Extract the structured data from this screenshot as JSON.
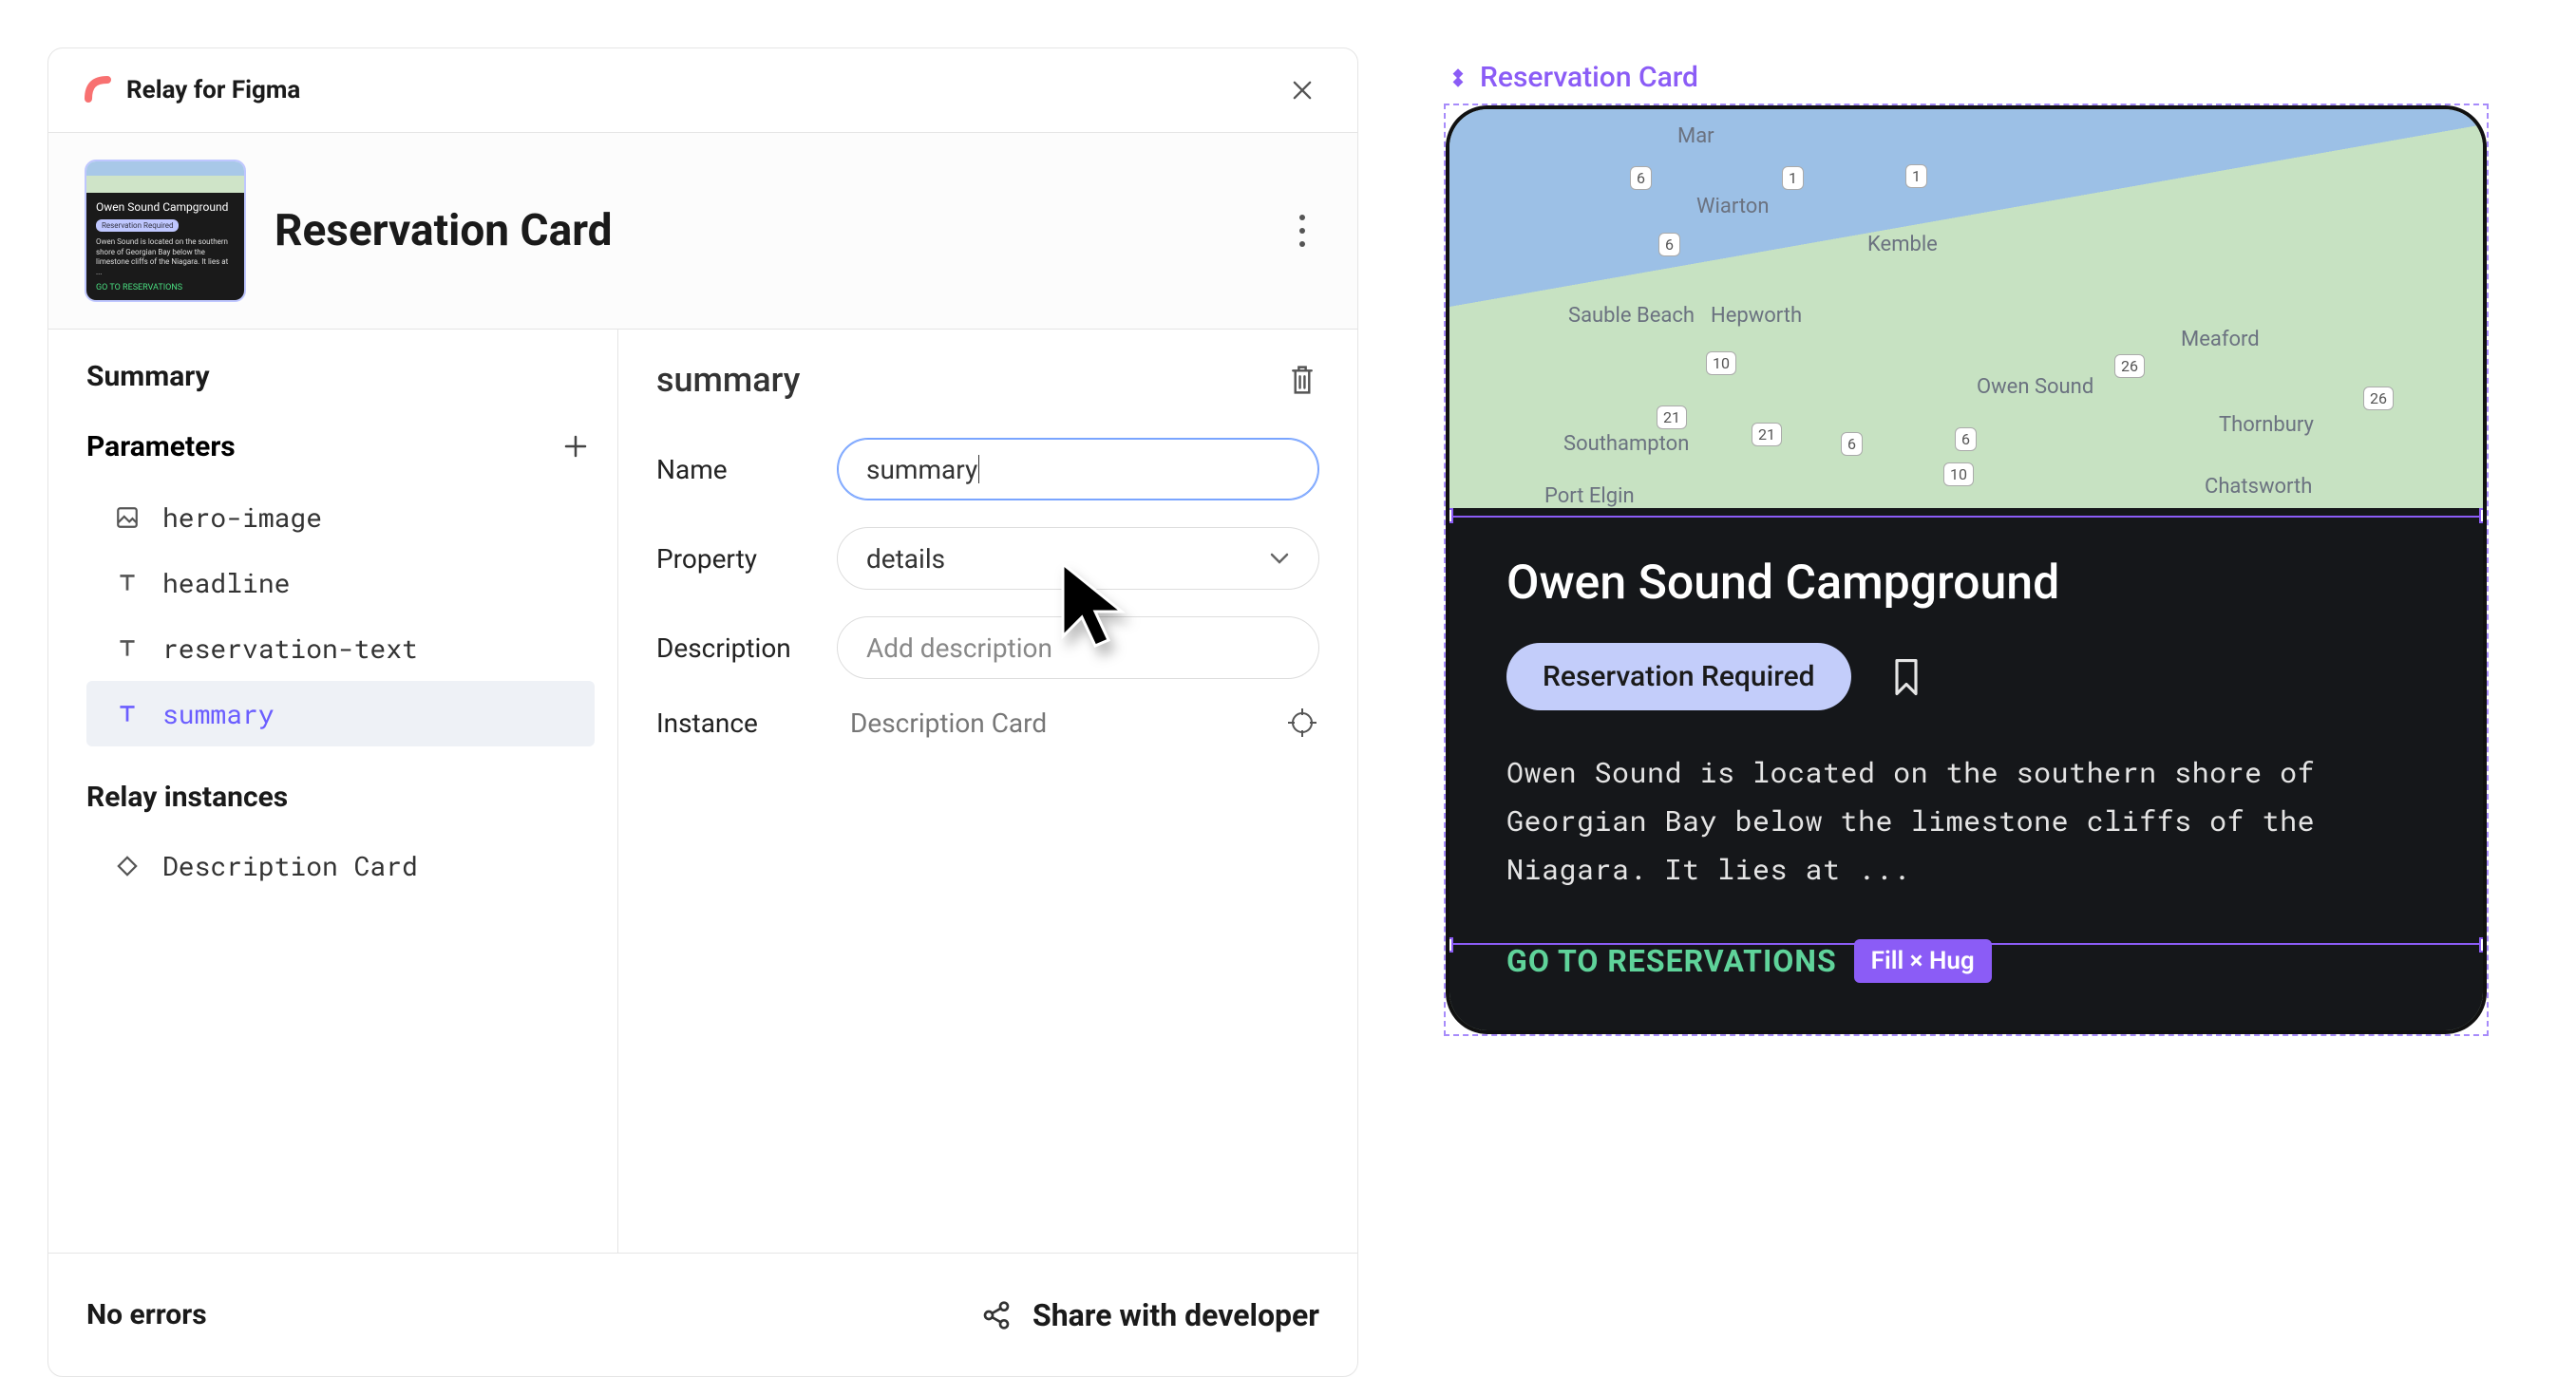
{
  "header": {
    "plugin_title": "Relay for Figma"
  },
  "component": {
    "name": "Reservation Card"
  },
  "sidebar": {
    "summary_label": "Summary",
    "parameters_label": "Parameters",
    "instances_label": "Relay instances",
    "params": [
      {
        "name": "hero-image",
        "icon": "image"
      },
      {
        "name": "headline",
        "icon": "text"
      },
      {
        "name": "reservation-text",
        "icon": "text"
      },
      {
        "name": "summary",
        "icon": "text",
        "active": true
      }
    ],
    "instances": [
      {
        "name": "Description Card"
      }
    ]
  },
  "detail": {
    "title": "summary",
    "name_label": "Name",
    "name_value": "summary",
    "property_label": "Property",
    "property_value": "details",
    "description_label": "Description",
    "description_placeholder": "Add description",
    "instance_label": "Instance",
    "instance_value": "Description Card"
  },
  "footer": {
    "status": "No errors",
    "share_label": "Share with developer"
  },
  "preview": {
    "component_label": "Reservation Card",
    "headline": "Owen Sound Campground",
    "reservation_text": "Reservation Required",
    "summary": "Owen Sound is located on the southern shore of Georgian Bay below the limestone cliffs of the Niagara. It lies at ...",
    "cta": "GO TO RESERVATIONS",
    "layout_chip": "Fill × Hug",
    "map_labels": {
      "mar": "Mar",
      "wiarton": "Wiarton",
      "kemble": "Kemble",
      "sauble": "Sauble Beach",
      "hepworth": "Hepworth",
      "owen": "Owen Sound",
      "meaford": "Meaford",
      "thornbury": "Thornbury",
      "chatsworth": "Chatsworth",
      "southampton": "Southampton",
      "portelgin": "Port Elgin"
    }
  }
}
